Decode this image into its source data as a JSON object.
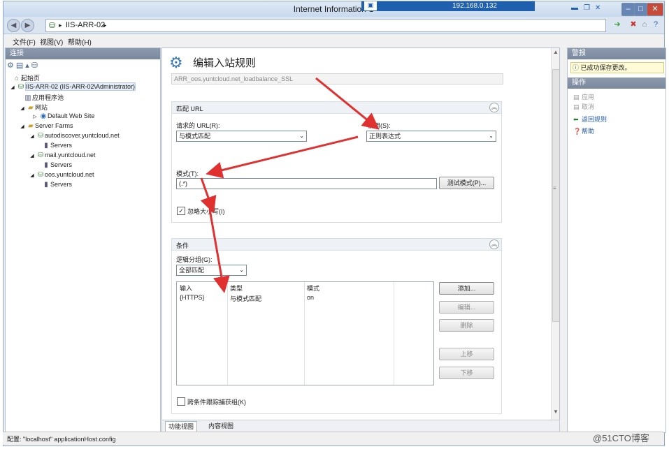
{
  "window": {
    "title": "Internet Information S",
    "remote_ip": "192.168.0.132"
  },
  "address": {
    "server": "IIS-ARR-02",
    "crumb_sep": "▸"
  },
  "menu": {
    "file": "文件(F)",
    "view": "视图(V)",
    "help": "帮助(H)"
  },
  "connections": {
    "header": "连接",
    "tree": [
      {
        "label": "起始页",
        "icon": "start-page-icon"
      },
      {
        "label": "IIS-ARR-02 (IIS-ARR-02\\Administrator)",
        "icon": "server-icon"
      },
      {
        "label": "应用程序池",
        "icon": "app-pools-icon"
      },
      {
        "label": "网站",
        "icon": "sites-folder-icon"
      },
      {
        "label": "Default Web Site",
        "icon": "globe-icon"
      },
      {
        "label": "Server Farms",
        "icon": "server-farms-icon"
      },
      {
        "label": "autodiscover.yuntcloud.net",
        "icon": "server-farm-icon"
      },
      {
        "label": "Servers",
        "icon": "servers-icon"
      },
      {
        "label": "mail.yuntcloud.net",
        "icon": "server-farm-icon"
      },
      {
        "label": "Servers",
        "icon": "servers-icon"
      },
      {
        "label": "oos.yuntcloud.net",
        "icon": "server-farm-icon"
      },
      {
        "label": "Servers",
        "icon": "servers-icon"
      }
    ]
  },
  "editor": {
    "title": "编辑入站规则",
    "rule_name": "ARR_oos.yuntcloud.net_loadbalance_SSL",
    "match": {
      "header": "匹配 URL",
      "requested_url_label": "请求的 URL(R):",
      "requested_url_value": "与模式匹配",
      "using_label": "使用(S):",
      "using_value": "正则表达式",
      "pattern_label": "模式(T):",
      "pattern_value": "(.*)",
      "test_button": "测试模式(P)...",
      "ignore_case_label": "忽略大小写(I)",
      "ignore_case_checked": true
    },
    "conditions": {
      "header": "条件",
      "logical_group_label": "逻辑分组(G):",
      "logical_group_value": "全部匹配",
      "columns": [
        "输入",
        "类型",
        "模式"
      ],
      "rows": [
        {
          "input": "{HTTPS}",
          "type": "与模式匹配",
          "pattern": "on"
        }
      ],
      "buttons": {
        "add": "添加...",
        "edit": "编辑...",
        "remove": "删除",
        "up": "上移",
        "down": "下移"
      },
      "track_label": "跨条件跟踪捕获组(K)",
      "track_checked": false
    }
  },
  "tabs": {
    "features": "功能视图",
    "content": "内容视图"
  },
  "actions": {
    "alerts_header": "警报",
    "alert_text": "已成功保存更改。",
    "actions_header": "操作",
    "items": [
      {
        "label": "应用",
        "enabled": false
      },
      {
        "label": "取消",
        "enabled": false
      },
      {
        "label": "返回规则",
        "enabled": true
      },
      {
        "label": "帮助",
        "enabled": true
      }
    ]
  },
  "status": {
    "text": "配置: \"localhost\" applicationHost.config"
  },
  "watermark": "@51CTO博客",
  "colors": {
    "accent": "#1e5fae",
    "annotation": "#e03030",
    "alert_bg": "#fffbd6"
  }
}
